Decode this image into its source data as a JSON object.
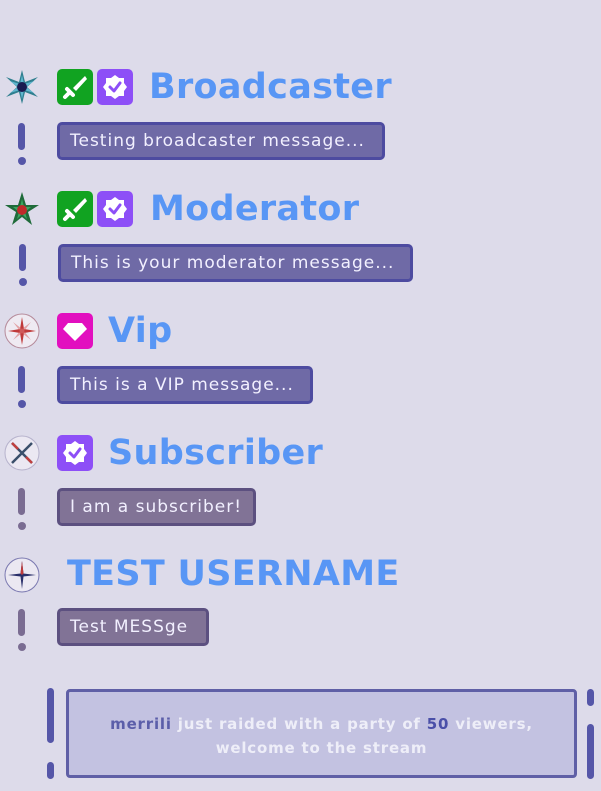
{
  "messages": [
    {
      "username": "Broadcaster",
      "text": "Testing broadcaster message...",
      "badges": [
        "sword-icon",
        "verified-icon"
      ],
      "role_icon": "star-burst-icon"
    },
    {
      "username": "Moderator",
      "text": "This is your moderator message...",
      "badges": [
        "sword-icon",
        "verified-icon"
      ],
      "role_icon": "leaf-star-icon"
    },
    {
      "username": "Vip",
      "text": "This is a VIP message...",
      "badges": [
        "diamond-icon"
      ],
      "role_icon": "compass-rose-icon"
    },
    {
      "username": "Subscriber",
      "text": "I am a subscriber!",
      "badges": [
        "verified-icon"
      ],
      "role_icon": "compass-cross-icon"
    },
    {
      "username": "TEST USERNAME",
      "text": "Test MESSge",
      "badges": [],
      "role_icon": "compass-needle-icon"
    }
  ],
  "raid": {
    "raider": "merrili",
    "text_before": " just raided with a party of ",
    "viewers": "50",
    "text_after": " viewers,",
    "line2": "welcome to the stream"
  },
  "colors": {
    "background": "#dddbea",
    "username": "#5896f5",
    "mod_badge": "#11a321",
    "sub_badge": "#8d4ff7",
    "vip_badge": "#e20fbf",
    "message_bg_blue": "#6f6aa6",
    "message_bg_grey": "#817396"
  }
}
